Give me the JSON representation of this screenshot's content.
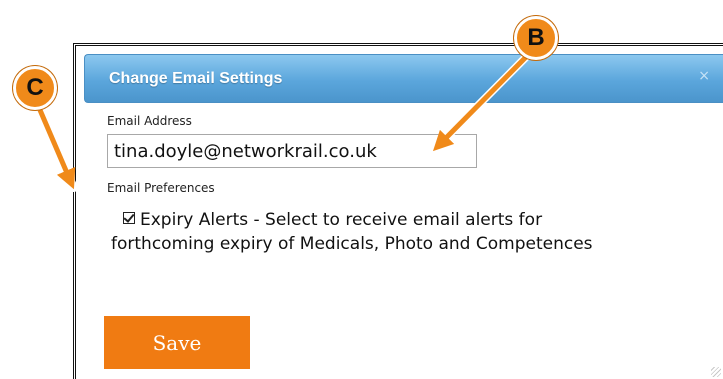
{
  "dialog": {
    "title": "Change Email Settings",
    "close_symbol": "×",
    "email_label": "Email Address",
    "email_value": "tina.doyle@networkrail.co.uk",
    "preferences_label": "Email Preferences",
    "expiry_alerts": {
      "checked": true,
      "line1": "Expiry Alerts - Select to receive email alerts for",
      "line2": "forthcoming expiry of Medicals, Photo and Competences"
    },
    "save_label": "Save"
  },
  "callouts": {
    "b": "B",
    "c": "C"
  },
  "colors": {
    "titlebar": "#5ba6dc",
    "save_button": "#f07b12",
    "callout": "#f08a1a"
  }
}
